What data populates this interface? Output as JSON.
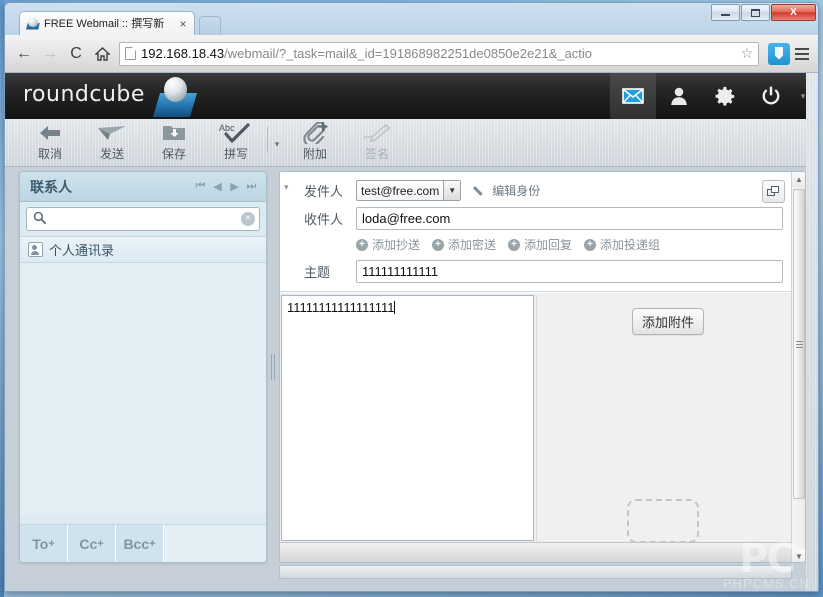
{
  "browser": {
    "tab": {
      "title": "FREE Webmail :: 撰写新",
      "favicon": "roundcube-favicon",
      "close_label": "×"
    },
    "nav": {
      "back": "←",
      "forward": "→",
      "reload": "C",
      "home": "⌂"
    },
    "url": {
      "host": "192.168.18.43",
      "path": "/webmail/?_task=mail&_id=191868982251de0850e2e21&_actio"
    },
    "star": "☆",
    "window_controls": {
      "minimize": "minimize",
      "maximize": "maximize",
      "close": "X"
    }
  },
  "rc_header": {
    "logo": "roundcube",
    "tasks": [
      {
        "name": "mail",
        "active": true
      },
      {
        "name": "contacts",
        "active": false
      },
      {
        "name": "settings",
        "active": false
      },
      {
        "name": "logout",
        "active": false
      }
    ],
    "caret": "▾"
  },
  "toolbar": {
    "buttons": [
      {
        "label": "取消",
        "icon": "back-arrow-icon",
        "disabled": false
      },
      {
        "label": "发送",
        "icon": "send-paperplane-icon",
        "disabled": false
      },
      {
        "label": "保存",
        "icon": "save-folder-icon",
        "disabled": false
      },
      {
        "label": "拼写",
        "icon": "spellcheck-abc-icon",
        "disabled": false
      },
      {
        "label": "附加",
        "icon": "paperclip-plus-icon",
        "disabled": false
      },
      {
        "label": "签名",
        "icon": "signature-pen-icon",
        "disabled": true
      }
    ],
    "spell_caret": "▾"
  },
  "contacts": {
    "title": "联系人",
    "pager": [
      "⏮",
      "◀",
      "▶",
      "⏭"
    ],
    "search": {
      "value": "",
      "placeholder": "",
      "clear": "×"
    },
    "sources": [
      {
        "label": "个人通讯录",
        "icon": "addressbook-icon"
      }
    ],
    "recipient_buttons": [
      {
        "label": "To",
        "sup": "+"
      },
      {
        "label": "Cc",
        "sup": "+"
      },
      {
        "label": "Bcc",
        "sup": "+"
      }
    ]
  },
  "compose": {
    "collapse_caret": "▾",
    "from": {
      "label": "发件人",
      "value": "test@free.com",
      "caret": "▼"
    },
    "edit_identity": "编辑身份",
    "to": {
      "label": "收件人",
      "value": "loda@free.com",
      "placeholder": ""
    },
    "add_links": [
      {
        "label": "添加抄送",
        "icon": "plus-icon"
      },
      {
        "label": "添加密送",
        "icon": "plus-icon"
      },
      {
        "label": "添加回复",
        "icon": "plus-icon"
      },
      {
        "label": "添加投递组",
        "icon": "plus-icon"
      }
    ],
    "subject": {
      "label": "主题",
      "value": "111111111111",
      "placeholder": ""
    },
    "body": {
      "value": "11111111111111111"
    },
    "popup_button": "popup-window-icon",
    "attach_button": "添加附件",
    "dropzone": "attachment-dropzone"
  },
  "watermark": {
    "logo": "PC",
    "text": "PHPCMS.CN"
  }
}
